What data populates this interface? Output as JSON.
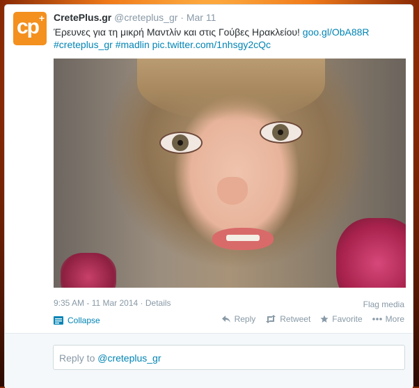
{
  "tweet": {
    "author_name": "CretePlus.gr",
    "handle": "@creteplus_gr",
    "separator": "·",
    "date": "Mar 11",
    "avatar": {
      "text": "cp",
      "badge": "+",
      "color": "#f3901e"
    },
    "text_main": "Έρευνες για τη μικρή Μαντλίν και στις Γούβες Ηρακλείου!",
    "link_url": "goo.gl/ObA88R",
    "hashtag_1": "#creteplus_gr",
    "hashtag_2": "#madlin",
    "pic_link": "pic.twitter.com/1nhsgy2cQc",
    "timestamp": "9:35 AM - 11 Mar 2014",
    "meta_separator": "·",
    "details_label": "Details",
    "flag_label": "Flag media",
    "collapse_label": "Collapse"
  },
  "actions": {
    "reply_label": "Reply",
    "retweet_label": "Retweet",
    "favorite_label": "Favorite",
    "more_label": "More"
  },
  "reply_box": {
    "prefix": "Reply to",
    "mention": "@creteplus_gr"
  },
  "colors": {
    "link": "#0084b4",
    "muted": "#8899a6",
    "text": "#292f33",
    "brand": "#f3901e"
  }
}
